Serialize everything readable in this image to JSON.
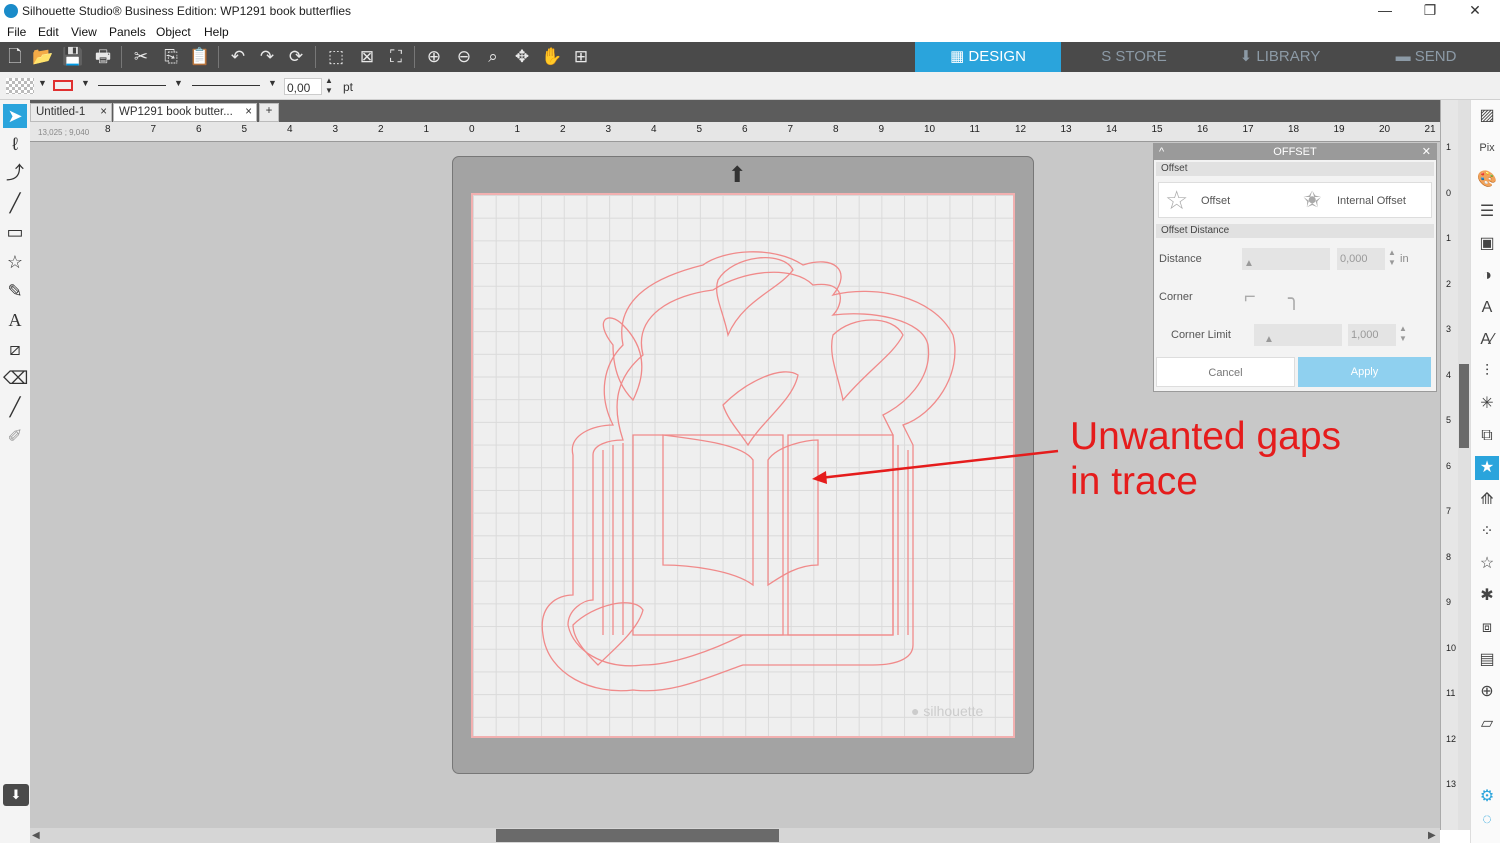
{
  "window": {
    "title": "Silhouette Studio® Business Edition: WP1291 book butterflies",
    "minimize": "—",
    "maximize": "❐",
    "close": "✕"
  },
  "menu": [
    "File",
    "Edit",
    "View",
    "Panels",
    "Object",
    "Help"
  ],
  "nav_tabs": [
    {
      "label": "DESIGN",
      "icon": "grid-icon",
      "glyph": "▦",
      "active": true
    },
    {
      "label": "STORE",
      "icon": "silhouette-s-icon",
      "glyph": "S",
      "active": false
    },
    {
      "label": "LIBRARY",
      "icon": "download-icon",
      "glyph": "⬇",
      "active": false
    },
    {
      "label": "SEND",
      "icon": "cutter-icon",
      "glyph": "▬",
      "active": false
    }
  ],
  "options": {
    "line_width": "0,00",
    "unit": "pt"
  },
  "doc_tabs": [
    {
      "label": "Untitled-1",
      "close": "×"
    },
    {
      "label": "WP1291 book butter...",
      "close": "×"
    }
  ],
  "add_tab": "+",
  "coords": "13,025 ; 9,040",
  "ruler": {
    "h_ticks": [
      "8",
      "7",
      "6",
      "5",
      "4",
      "3",
      "2",
      "1",
      "0",
      "1",
      "2",
      "3",
      "4",
      "5",
      "6",
      "7",
      "8",
      "9",
      "10",
      "11",
      "12",
      "13",
      "14",
      "15",
      "16",
      "17",
      "18",
      "19",
      "20",
      "21"
    ],
    "v_ticks": [
      "1",
      "0",
      "1",
      "2",
      "3",
      "4",
      "5",
      "6",
      "7",
      "8",
      "9",
      "10",
      "11",
      "12",
      "13"
    ]
  },
  "mat": {
    "watermark": "silhouette"
  },
  "offset_panel": {
    "title": "OFFSET",
    "section_offset": "Offset",
    "offset_label": "Offset",
    "internal_offset_label": "Internal Offset",
    "section_distance": "Offset Distance",
    "distance_label": "Distance",
    "distance_value": "0,000",
    "distance_unit": "in",
    "corner_label": "Corner",
    "corner_limit_label": "Corner Limit",
    "corner_limit_value": "1,000",
    "cancel_label": "Cancel",
    "apply_label": "Apply"
  },
  "annotation": {
    "line1": "Unwanted gaps",
    "line2": "in trace",
    "color": "#e51c1c"
  },
  "colors": {
    "accent": "#2aa4dc",
    "toolbar": "#4a4a4a",
    "cut_line": "#f08a8a"
  }
}
